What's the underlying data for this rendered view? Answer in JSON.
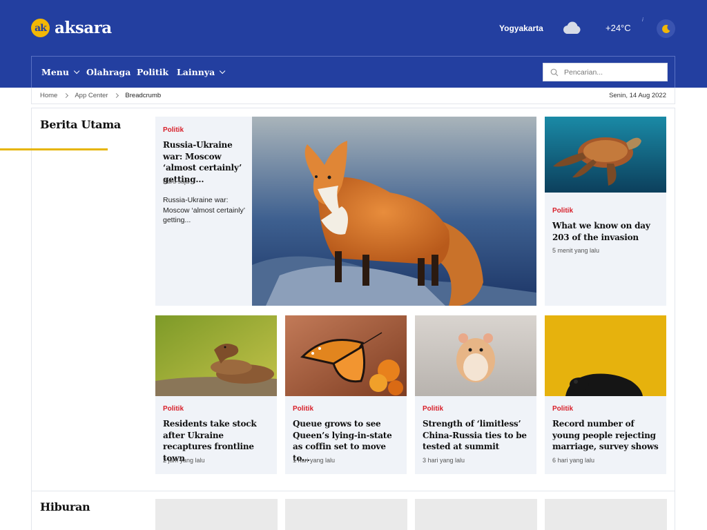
{
  "brand": {
    "logo_mark": "ak",
    "name": "aksara"
  },
  "header": {
    "city": "Yogyakarta",
    "weather_icon": "cloud-icon",
    "temperature": "+24°C",
    "info_glyph": "i",
    "theme_icon": "moon-icon"
  },
  "nav": {
    "items": [
      {
        "label": "Menu",
        "has_dropdown": true
      },
      {
        "label": "Olahraga",
        "has_dropdown": false
      },
      {
        "label": "Politik",
        "has_dropdown": false
      },
      {
        "label": "Lainnya",
        "has_dropdown": true
      }
    ],
    "search_placeholder": "Pencarian..."
  },
  "breadcrumb": {
    "items": [
      "Home",
      "App Center",
      "Breadcrumb"
    ],
    "date": "Senin, 14 Aug 2022"
  },
  "sections": {
    "main_title": "Berita Utama",
    "second_title": "Hiburan"
  },
  "featured": {
    "category": "Politik",
    "title": "Russia-Ukraine war: Moscow ‘almost certainly’ getting...",
    "time": "Baru saja",
    "excerpt": "Russia-Ukraine war: Moscow ‘almost certainly’ getting...",
    "image": "red fox standing on snowy rock"
  },
  "side_card": {
    "category": "Politik",
    "title": "What we know on day 203 of the invasion",
    "time": "5 menit yang lalu",
    "image": "sea turtle swimming"
  },
  "cards": [
    {
      "category": "Politik",
      "title": "Residents take stock after Ukraine recaptures frontline town",
      "time": "2 jam yang lalu",
      "image": "coiled snake on rock"
    },
    {
      "category": "Politik",
      "title": "Queue grows to see Queen’s lying-in-state as coffin set to move to...",
      "time": "1 hari yang lalu",
      "image": "monarch butterfly on orange flower"
    },
    {
      "category": "Politik",
      "title": "Strength of ‘limitless’ China-Russia ties to be tested at summit",
      "time": "3 hari yang lalu",
      "image": "hamster on grey surface"
    },
    {
      "category": "Politik",
      "title": "Record number of young people rejecting marriage, survey shows",
      "time": "6 hari yang lalu",
      "image": "black dog peeking over yellow background"
    }
  ],
  "colors": {
    "header_bg": "#233fa0",
    "accent_yellow": "#e6b400",
    "category_red": "#d8202a",
    "card_bg": "#f0f3f8"
  }
}
